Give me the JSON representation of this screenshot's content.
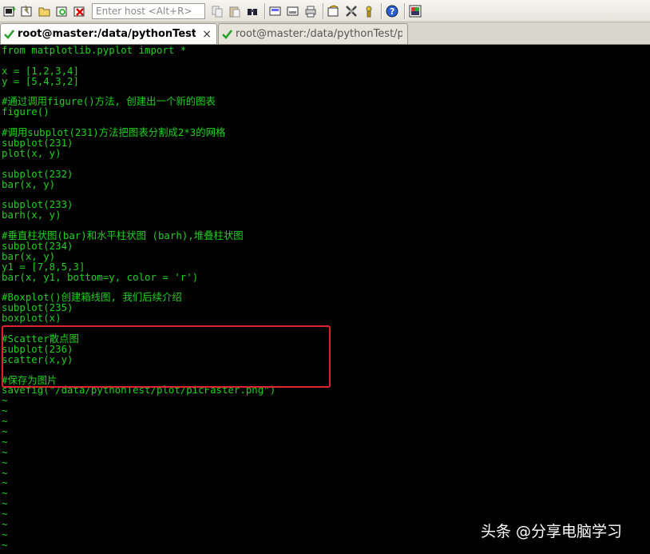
{
  "toolbar": {
    "host_placeholder": "Enter host <Alt+R>",
    "icons": [
      "new-session-icon",
      "quick-connect-icon",
      "folder-icon",
      "reconnect-icon",
      "disconnect-icon",
      "copy-icon",
      "paste-icon",
      "find-icon",
      "print-icon",
      "print-setup-icon",
      "print-screen-icon",
      "session-options-icon",
      "global-options-icon",
      "keymap-icon",
      "help-icon",
      "screen-icon"
    ]
  },
  "tabs": [
    {
      "label": "root@master:/data/pythonTest/plot",
      "active": true,
      "close": "×"
    },
    {
      "label": "root@master:/data/pythonTest/plot",
      "active": false
    }
  ],
  "terminal": {
    "lines": [
      "from matplotlib.pyplot import *",
      "",
      "x = [1,2,3,4]",
      "y = [5,4,3,2]",
      "",
      "#通过调用figure()方法, 创建出一个新的图表",
      "figure()",
      "",
      "#调用subplot(231)方法把图表分割成2*3的网格",
      "subplot(231)",
      "plot(x, y)",
      "",
      "subplot(232)",
      "bar(x, y)",
      "",
      "subplot(233)",
      "barh(x, y)",
      "",
      "#垂直柱状图(bar)和水平柱状图 (barh),堆叠柱状图",
      "subplot(234)",
      "bar(x, y)",
      "y1 = [7,8,5,3]",
      "bar(x, y1, bottom=y, color = 'r')",
      "",
      "#Boxplot()创建箱线图, 我们后续介绍",
      "subplot(235)",
      "boxplot(x)",
      "",
      "#Scatter散点图",
      "subplot(236)",
      "scatter(x,y)",
      "",
      "#保存为图片",
      "savefig(\"/data/pythonTest/plot/picFaster.png\")",
      "~",
      "~",
      "~",
      "~",
      "~",
      "~",
      "~",
      "~",
      "~",
      "~",
      "~",
      "~",
      "~",
      "~",
      "~",
      "~",
      "~",
      "~"
    ]
  },
  "watermark": "头条 @分享电脑学习",
  "colors": {
    "terminal_fg": "#1fd11f",
    "terminal_bg": "#000000",
    "highlight": "#e0232a"
  }
}
